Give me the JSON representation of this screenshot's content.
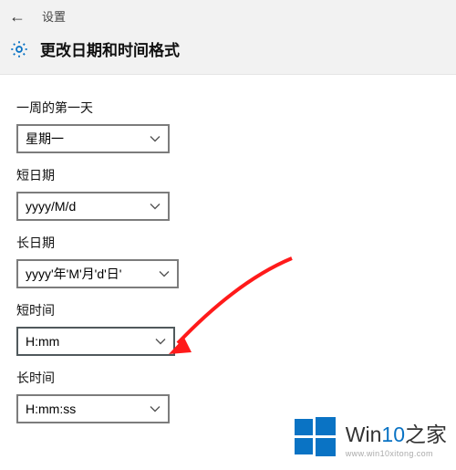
{
  "header": {
    "settings_text": "设置",
    "page_title": "更改日期和时间格式"
  },
  "fields": {
    "first_day": {
      "label": "一周的第一天",
      "value": "星期一"
    },
    "short_date": {
      "label": "短日期",
      "value": "yyyy/M/d"
    },
    "long_date": {
      "label": "长日期",
      "value": "yyyy'年'M'月'd'日'"
    },
    "short_time": {
      "label": "短时间",
      "value": "H:mm"
    },
    "long_time": {
      "label": "长时间",
      "value": "H:mm:ss"
    }
  },
  "watermark": {
    "main_prefix": "Win",
    "main_blue": "10",
    "main_suffix": "之家",
    "sub": "www.win10xitong.com"
  }
}
